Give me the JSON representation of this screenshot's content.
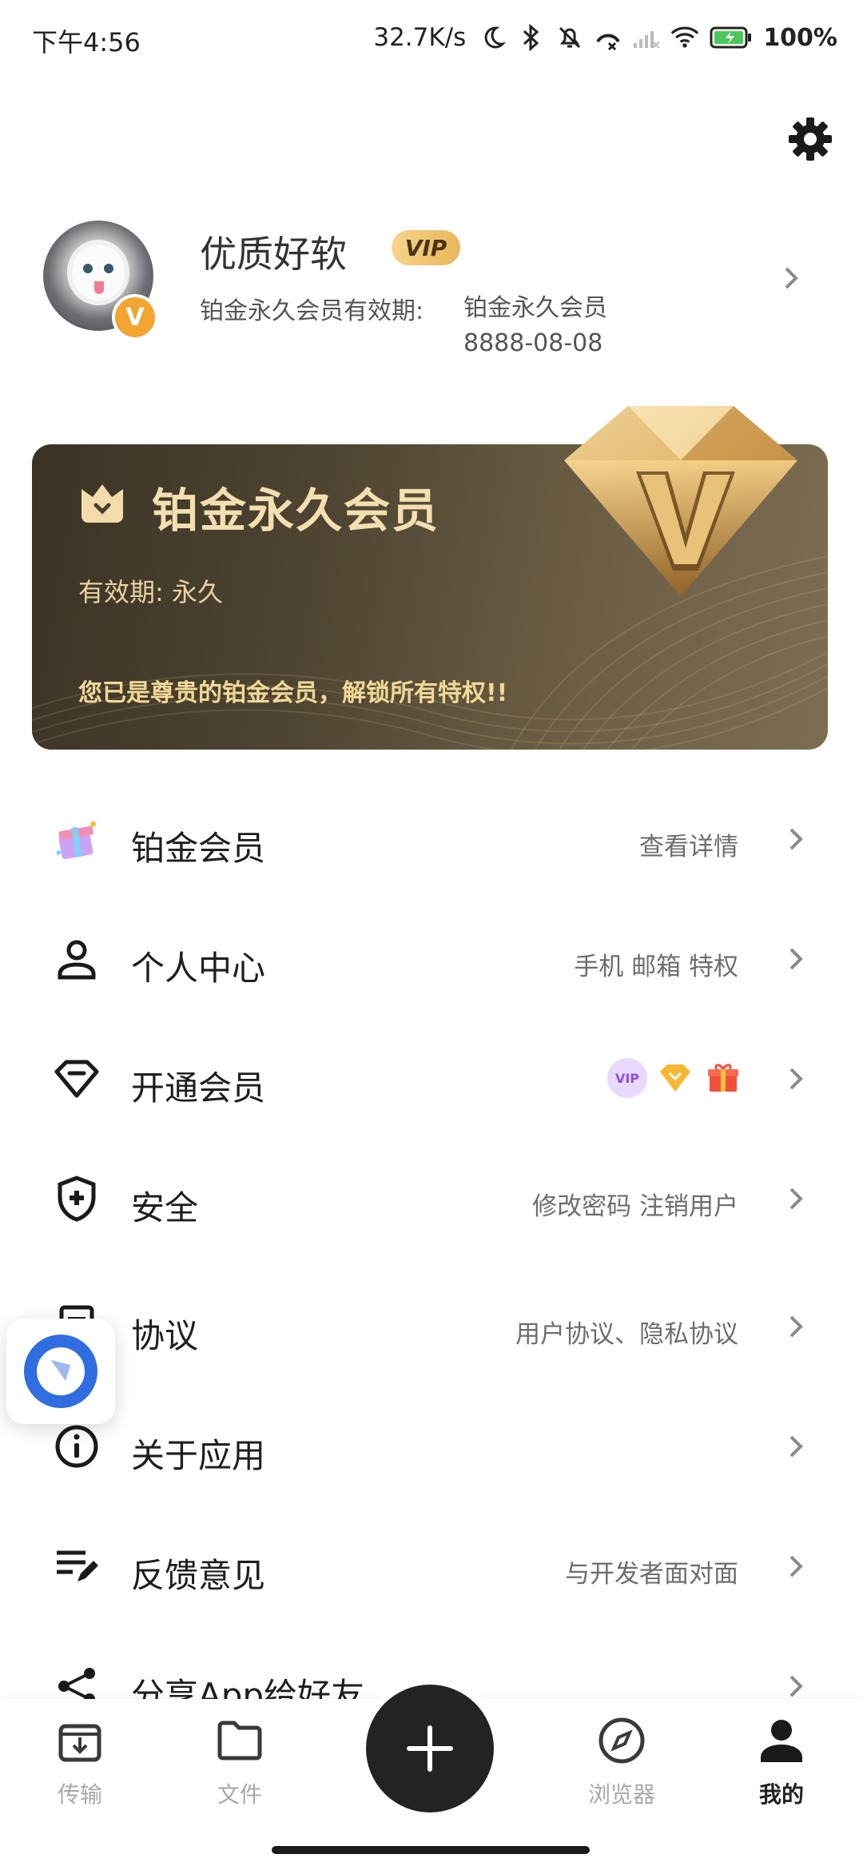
{
  "status_bar": {
    "time": "下午4:56",
    "net_speed": "32.7K/s",
    "battery": "100%"
  },
  "profile": {
    "name": "优质好软",
    "vip_tag": "VIP",
    "validity_label": "铂金永久会员有效期:",
    "validity_value": "铂金永久会员 8888-08-08",
    "badge_letter": "V"
  },
  "member_card": {
    "title": "铂金永久会员",
    "validity": "有效期: 永久",
    "description": "您已是尊贵的铂金会员，解锁所有特权!!"
  },
  "menu": [
    {
      "label": "铂金会员",
      "hint": "查看详情",
      "icon": "gift-box-icon"
    },
    {
      "label": "个人中心",
      "hint": "手机 邮箱 特权",
      "icon": "person-icon"
    },
    {
      "label": "开通会员",
      "hint": "",
      "icon": "diamond-icon"
    },
    {
      "label": "安全",
      "hint": "修改密码  注销用户",
      "icon": "shield-plus-icon"
    },
    {
      "label": "协议",
      "hint": "用户协议、隐私协议",
      "icon": "document-icon"
    },
    {
      "label": "关于应用",
      "hint": "",
      "icon": "info-icon"
    },
    {
      "label": "反馈意见",
      "hint": "与开发者面对面",
      "icon": "feedback-edit-icon"
    },
    {
      "label": "分享App给好友",
      "hint": "",
      "icon": "share-icon"
    }
  ],
  "nav": [
    {
      "label": "传输",
      "icon": "transfer-icon"
    },
    {
      "label": "文件",
      "icon": "folder-icon"
    },
    {
      "label": "浏览器",
      "icon": "compass-icon"
    },
    {
      "label": "我的",
      "icon": "profile-icon"
    }
  ],
  "colors": {
    "accent_gold": "#f2a531",
    "card_dark": "#3a3326",
    "card_text": "#f4dfb1",
    "fab": "#232323"
  }
}
